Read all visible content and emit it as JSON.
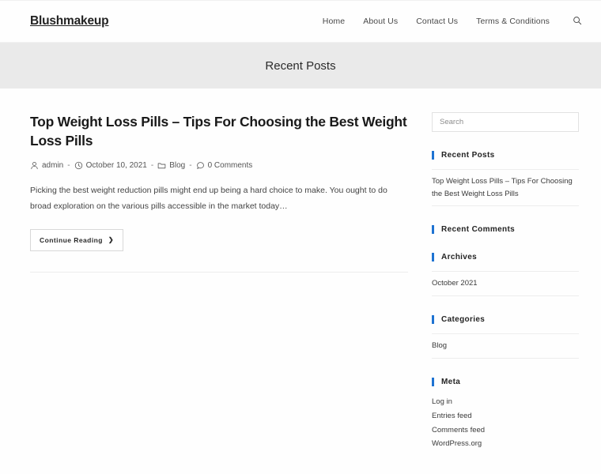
{
  "site": {
    "logo": "Blushmakeup",
    "nav": [
      {
        "label": "Home"
      },
      {
        "label": "About Us"
      },
      {
        "label": "Contact Us"
      },
      {
        "label": "Terms & Conditions"
      }
    ],
    "search_icon": "search-icon"
  },
  "banner": {
    "title": "Recent Posts"
  },
  "post": {
    "title": "Top Weight Loss Pills – Tips For Choosing the Best Weight Loss Pills",
    "meta": {
      "author": "admin",
      "date": "October 10, 2021",
      "category": "Blog",
      "comments": "0 Comments",
      "separator": "-"
    },
    "excerpt": "Picking the best weight reduction pills might end up being a hard choice to make. You ought to do broad exploration on the various pills accessible in the market today…",
    "read_more": "Continue Reading",
    "read_more_chevron": "❯"
  },
  "sidebar": {
    "search": {
      "placeholder": "Search",
      "value": ""
    },
    "widgets": [
      {
        "title": "Recent Posts",
        "items": [
          "Top Weight Loss Pills – Tips For Choosing the Best Weight Loss Pills"
        ]
      },
      {
        "title": "Recent Comments",
        "items": []
      },
      {
        "title": "Archives",
        "items": [
          "October 2021"
        ]
      },
      {
        "title": "Categories",
        "items": [
          "Blog"
        ]
      },
      {
        "title": "Meta",
        "items": [
          "Log in",
          "Entries feed",
          "Comments feed",
          "WordPress.org"
        ]
      }
    ]
  },
  "colors": {
    "accent": "#1e73d2",
    "banner_bg": "#eaeaea",
    "page_bg": "#fefefe",
    "text": "#333333"
  }
}
